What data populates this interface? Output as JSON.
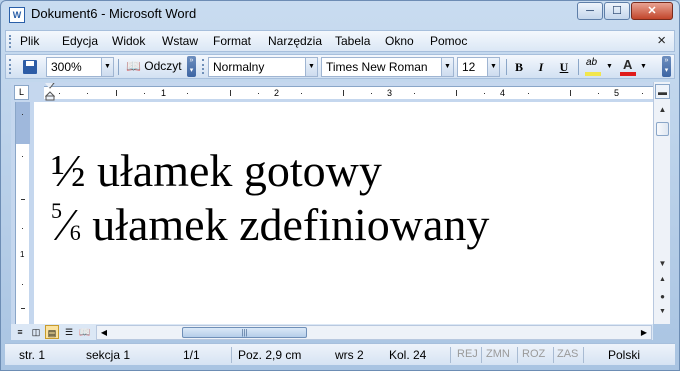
{
  "window": {
    "title": "Dokument6 - Microsoft Word",
    "min_label": "─",
    "max_label": "☐",
    "close_label": "✕",
    "app_icon_letter": "W"
  },
  "menu": {
    "items": [
      "Plik",
      "Edycja",
      "Widok",
      "Wstaw",
      "Format",
      "Narzędzia",
      "Tabela",
      "Okno",
      "Pomoc"
    ],
    "close_label": "×"
  },
  "toolbar": {
    "zoom": "300%",
    "read_label": "Odczyt",
    "style": "Normalny",
    "font": "Times New Roman",
    "size": "12",
    "bold": "B",
    "italic": "I",
    "underline": "U",
    "font_color_label": "A",
    "highlight_label": "ab"
  },
  "ruler": {
    "numbers": [
      "1",
      "2",
      "3",
      "4",
      "5"
    ],
    "corner_label": "L",
    "v_numbers": [
      "1"
    ]
  },
  "document": {
    "line1": {
      "numerator": "1",
      "denominator": "2",
      "text": "ułamek gotowy",
      "glyph": "½"
    },
    "line2": {
      "numerator": "5",
      "denominator": "6",
      "text": "ułamek zdefiniowany"
    }
  },
  "status": {
    "page": "str. 1",
    "section": "sekcja 1",
    "pages": "1/1",
    "position": "Poz. 2,9 cm",
    "line": "wrs 2",
    "column": "Kol. 24",
    "rec": "REJ",
    "trk": "ZMN",
    "ext": "ROZ",
    "ovr": "ZAS",
    "language": "Polski"
  },
  "colors": {
    "highlight_bar": "#f2e64d",
    "font_color_bar": "#e01b1b",
    "accent": "#2a5fa8"
  }
}
